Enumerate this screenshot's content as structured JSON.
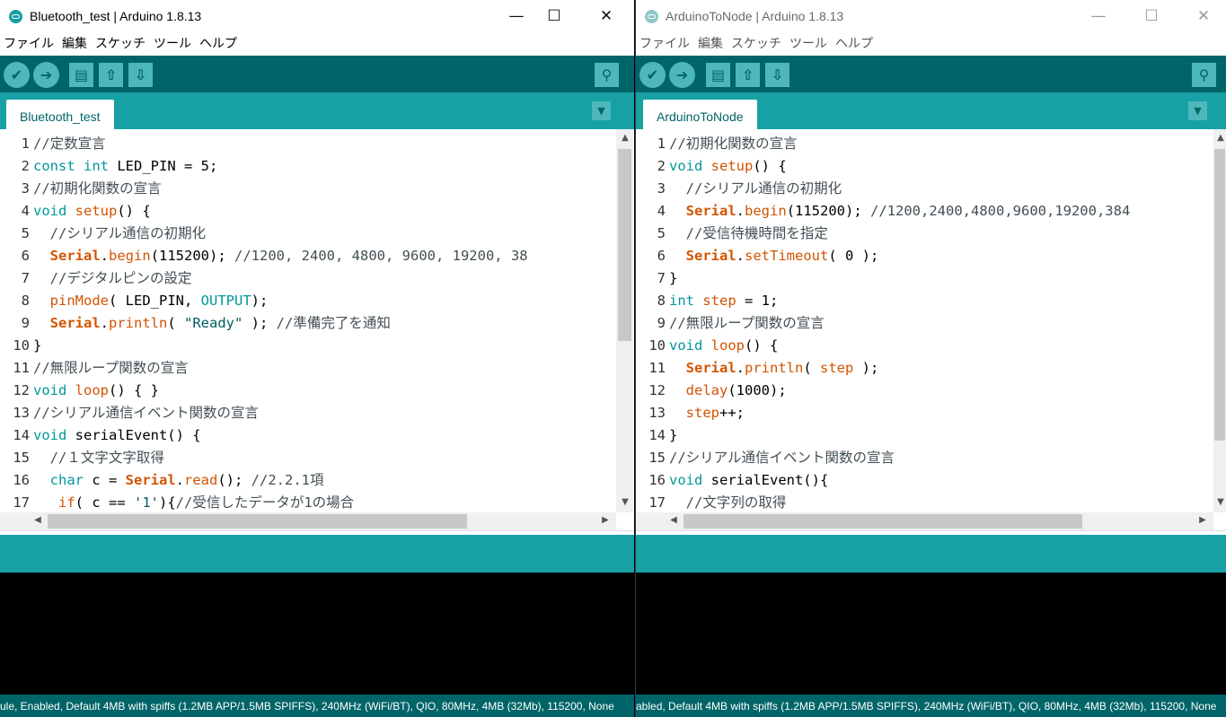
{
  "left_window": {
    "title": "Bluetooth_test | Arduino 1.8.13",
    "menu": [
      "ファイル",
      "編集",
      "スケッチ",
      "ツール",
      "ヘルプ"
    ],
    "tab_label": "Bluetooth_test",
    "line_numbers": [
      "1",
      "2",
      "3",
      "4",
      "5",
      "6",
      "7",
      "8",
      "9",
      "10",
      "11",
      "12",
      "13",
      "14",
      "15",
      "16",
      "17"
    ],
    "footer_text": "ule, Enabled, Default 4MB with spiffs (1.2MB APP/1.5MB SPIFFS), 240MHz (WiFi/BT), QIO, 80MHz, 4MB (32Mb), 115200, None",
    "code": [
      [
        {
          "t": "//定数宣言",
          "c": "cm"
        }
      ],
      [
        {
          "t": "const",
          "c": "kw"
        },
        {
          "t": " "
        },
        {
          "t": "int",
          "c": "kw"
        },
        {
          "t": " LED_PIN = 5;"
        }
      ],
      [
        {
          "t": "//初期化関数の宣言",
          "c": "cm"
        }
      ],
      [
        {
          "t": "void",
          "c": "kw"
        },
        {
          "t": " "
        },
        {
          "t": "setup",
          "c": "fn"
        },
        {
          "t": "() {"
        }
      ],
      [
        {
          "t": "  "
        },
        {
          "t": "//シリアル通信の初期化",
          "c": "cm"
        }
      ],
      [
        {
          "t": "  "
        },
        {
          "t": "Serial",
          "c": "ser"
        },
        {
          "t": "."
        },
        {
          "t": "begin",
          "c": "fn"
        },
        {
          "t": "(115200); "
        },
        {
          "t": "//1200, 2400, 4800, 9600, 19200, 38",
          "c": "cm"
        }
      ],
      [
        {
          "t": "  "
        },
        {
          "t": "//デジタルピンの設定",
          "c": "cm"
        }
      ],
      [
        {
          "t": "  "
        },
        {
          "t": "pinMode",
          "c": "fn"
        },
        {
          "t": "( LED_PIN, "
        },
        {
          "t": "OUTPUT",
          "c": "kw"
        },
        {
          "t": ");"
        }
      ],
      [
        {
          "t": "  "
        },
        {
          "t": "Serial",
          "c": "ser"
        },
        {
          "t": "."
        },
        {
          "t": "println",
          "c": "fn"
        },
        {
          "t": "( "
        },
        {
          "t": "\"Ready\"",
          "c": "str"
        },
        {
          "t": " ); "
        },
        {
          "t": "//準備完了を通知",
          "c": "cm"
        }
      ],
      [
        {
          "t": "}"
        }
      ],
      [
        {
          "t": "//無限ループ関数の宣言",
          "c": "cm"
        }
      ],
      [
        {
          "t": "void",
          "c": "kw"
        },
        {
          "t": " "
        },
        {
          "t": "loop",
          "c": "fn"
        },
        {
          "t": "() { }"
        }
      ],
      [
        {
          "t": "//シリアル通信イベント関数の宣言",
          "c": "cm"
        }
      ],
      [
        {
          "t": "void",
          "c": "kw"
        },
        {
          "t": " serialEvent() {"
        }
      ],
      [
        {
          "t": "  "
        },
        {
          "t": "//１文字文字取得",
          "c": "cm"
        }
      ],
      [
        {
          "t": "  "
        },
        {
          "t": "char",
          "c": "kw"
        },
        {
          "t": " c = "
        },
        {
          "t": "Serial",
          "c": "ser"
        },
        {
          "t": "."
        },
        {
          "t": "read",
          "c": "fn"
        },
        {
          "t": "(); "
        },
        {
          "t": "//2.2.1項",
          "c": "cm"
        }
      ],
      [
        {
          "t": "   "
        },
        {
          "t": "if",
          "c": "fn"
        },
        {
          "t": "( c == "
        },
        {
          "t": "'1'",
          "c": "str"
        },
        {
          "t": "){"
        },
        {
          "t": "//受信したデータが1の場合",
          "c": "cm"
        }
      ]
    ]
  },
  "right_window": {
    "title": "ArduinoToNode | Arduino 1.8.13",
    "menu": [
      "ファイル",
      "編集",
      "スケッチ",
      "ツール",
      "ヘルプ"
    ],
    "tab_label": "ArduinoToNode",
    "line_numbers": [
      "1",
      "2",
      "3",
      "4",
      "5",
      "6",
      "7",
      "8",
      "9",
      "10",
      "11",
      "12",
      "13",
      "14",
      "15",
      "16",
      "17"
    ],
    "footer_text": "abled, Default 4MB with spiffs (1.2MB APP/1.5MB SPIFFS), 240MHz (WiFi/BT), QIO, 80MHz, 4MB (32Mb), 115200, None",
    "code": [
      [
        {
          "t": "//初期化関数の宣言",
          "c": "cm"
        }
      ],
      [
        {
          "t": "void",
          "c": "kw"
        },
        {
          "t": " "
        },
        {
          "t": "setup",
          "c": "fn"
        },
        {
          "t": "() {"
        }
      ],
      [
        {
          "t": "  "
        },
        {
          "t": "//シリアル通信の初期化",
          "c": "cm"
        }
      ],
      [
        {
          "t": "  "
        },
        {
          "t": "Serial",
          "c": "ser"
        },
        {
          "t": "."
        },
        {
          "t": "begin",
          "c": "fn"
        },
        {
          "t": "(115200); "
        },
        {
          "t": "//1200,2400,4800,9600,19200,384",
          "c": "cm"
        }
      ],
      [
        {
          "t": "  "
        },
        {
          "t": "//受信待機時間を指定",
          "c": "cm"
        }
      ],
      [
        {
          "t": "  "
        },
        {
          "t": "Serial",
          "c": "ser"
        },
        {
          "t": "."
        },
        {
          "t": "setTimeout",
          "c": "fn"
        },
        {
          "t": "( 0 );"
        }
      ],
      [
        {
          "t": "}"
        }
      ],
      [
        {
          "t": "int",
          "c": "kw"
        },
        {
          "t": " "
        },
        {
          "t": "step",
          "c": "fn"
        },
        {
          "t": " = 1;"
        }
      ],
      [
        {
          "t": "//無限ループ関数の宣言",
          "c": "cm"
        }
      ],
      [
        {
          "t": "void",
          "c": "kw"
        },
        {
          "t": " "
        },
        {
          "t": "loop",
          "c": "fn"
        },
        {
          "t": "() {"
        }
      ],
      [
        {
          "t": "  "
        },
        {
          "t": "Serial",
          "c": "ser"
        },
        {
          "t": "."
        },
        {
          "t": "println",
          "c": "fn"
        },
        {
          "t": "( "
        },
        {
          "t": "step",
          "c": "fn"
        },
        {
          "t": " );"
        }
      ],
      [
        {
          "t": "  "
        },
        {
          "t": "delay",
          "c": "fn"
        },
        {
          "t": "(1000);"
        }
      ],
      [
        {
          "t": "  "
        },
        {
          "t": "step",
          "c": "fn"
        },
        {
          "t": "++;"
        }
      ],
      [
        {
          "t": "}"
        }
      ],
      [
        {
          "t": "//シリアル通信イベント関数の宣言",
          "c": "cm"
        }
      ],
      [
        {
          "t": "void",
          "c": "kw"
        },
        {
          "t": " serialEvent(){"
        }
      ],
      [
        {
          "t": "  "
        },
        {
          "t": "//文字列の取得",
          "c": "cm"
        }
      ]
    ]
  },
  "icons": {
    "minimize": "minimize-icon",
    "maximize": "maximize-icon",
    "close": "close-icon",
    "verify": "check-icon",
    "upload": "arrow-right-icon",
    "new": "document-icon",
    "open": "arrow-up-icon",
    "save": "arrow-down-icon",
    "serial_monitor": "magnifier-icon",
    "tab_menu": "triangle-down-icon"
  },
  "colors": {
    "toolbar": "#006468",
    "tabbar": "#17a1a5",
    "button": "#4db7bb",
    "keyword": "#00979c",
    "function": "#d35400",
    "comment": "#434f54"
  }
}
